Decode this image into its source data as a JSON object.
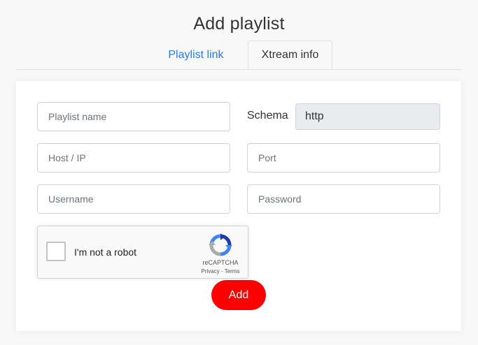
{
  "page": {
    "title": "Add playlist"
  },
  "tabs": [
    {
      "label": "Playlist link",
      "active": false
    },
    {
      "label": "Xtream info",
      "active": true
    }
  ],
  "form": {
    "playlist_name": {
      "placeholder": "Playlist name",
      "value": ""
    },
    "schema": {
      "label": "Schema",
      "value": "http"
    },
    "host": {
      "placeholder": "Host / IP",
      "value": ""
    },
    "port": {
      "placeholder": "Port",
      "value": ""
    },
    "username": {
      "placeholder": "Username",
      "value": ""
    },
    "password": {
      "placeholder": "Password",
      "value": ""
    }
  },
  "recaptcha": {
    "label": "I'm not a robot",
    "brand": "reCAPTCHA",
    "links": "Privacy - Terms",
    "checked": false
  },
  "actions": {
    "add_label": "Add"
  },
  "colors": {
    "accent": "#2a7ae2",
    "add_button": "#ff0000",
    "schema_bg": "#e9ecef"
  }
}
